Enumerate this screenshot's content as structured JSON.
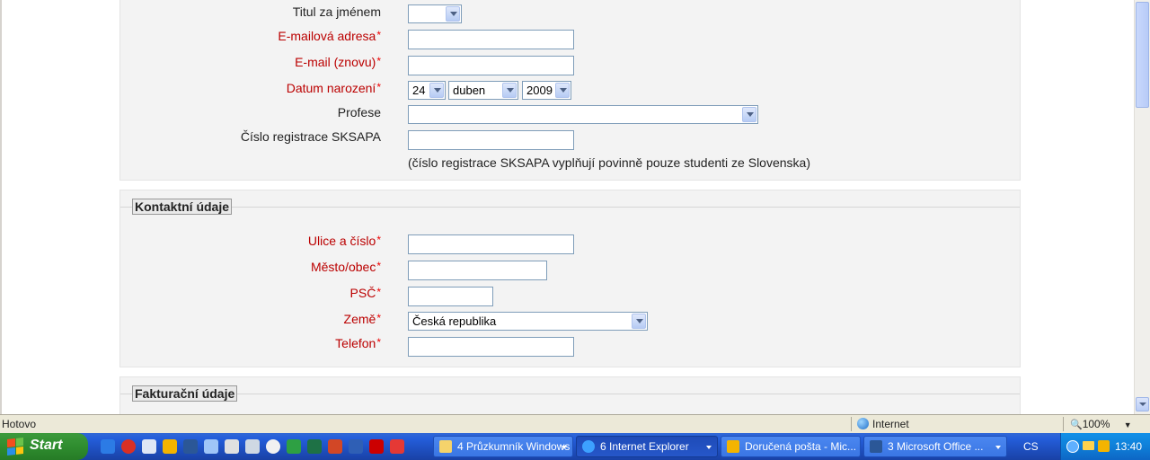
{
  "form": {
    "personal": {
      "title_after_label": "Titul za jménem",
      "email_label": "E-mailová adresa",
      "email_repeat_label": "E-mail (znovu)",
      "birthdate_label": "Datum narození",
      "birth_day": "24",
      "birth_month": "duben",
      "birth_year": "2009",
      "profession_label": "Profese",
      "sksapa_label": "Číslo registrace SKSAPA",
      "sksapa_note": "(číslo registrace SKSAPA vyplňují povinně pouze studenti ze Slovenska)"
    },
    "contact": {
      "legend": "Kontaktní údaje",
      "street_label": "Ulice a číslo",
      "city_label": "Město/obec",
      "zip_label": "PSČ",
      "country_label": "Země",
      "country_value": "Česká republika",
      "phone_label": "Telefon"
    },
    "billing": {
      "legend": "Fakturační údaje"
    },
    "required_mark": "*"
  },
  "statusbar": {
    "status": "Hotovo",
    "zone": "Internet",
    "zoom": "100%"
  },
  "taskbar": {
    "start_label": "Start",
    "tasks": [
      {
        "label": "4 Průzkumník Windows"
      },
      {
        "label": "6 Internet Explorer"
      },
      {
        "label": "Doručená pošta - Mic..."
      },
      {
        "label": "3 Microsoft Office ..."
      }
    ],
    "language": "CS",
    "clock": "13:40"
  },
  "colors": {
    "required_label": "#b00000",
    "taskbar_blue": "#245edb",
    "start_green": "#2f8d2f"
  }
}
